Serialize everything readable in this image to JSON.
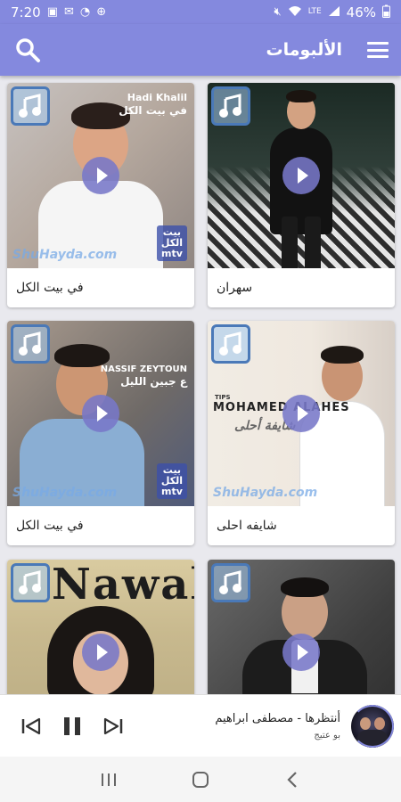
{
  "status": {
    "time": "7:20",
    "battery": "46%",
    "left_icons": [
      "gallery-icon",
      "mail-icon",
      "whatsapp-icon",
      "vpn-icon"
    ],
    "right_icons": [
      "mute-icon",
      "wifi-icon",
      "lte-icon",
      "signal-icon",
      "battery-icon"
    ]
  },
  "app_bar": {
    "title": "الألبومات",
    "accent": "#8489de"
  },
  "albums": [
    {
      "label": "في بيت الكل",
      "artist_line1": "Hadi Khalil",
      "artist_line2": "في بيت الكل",
      "watermark": "ShuHayda.com",
      "badge_line1": "بيت",
      "badge_line2": "الكل",
      "badge_line3": "mtv"
    },
    {
      "label": "سهران"
    },
    {
      "label": "في بيت الكل",
      "artist_line1": "NASSIF ZEYTOUN",
      "artist_line2": "ع جبين الليل",
      "watermark": "ShuHayda.com",
      "badge_line1": "بيت",
      "badge_line2": "الكل",
      "badge_line3": "mtv"
    },
    {
      "label": "شايفه احلى",
      "artist_line1": "TIPS",
      "artist_line2": "MOHAMED ALAHES",
      "script": "شايفة أحلى",
      "watermark": "ShuHayda.com"
    },
    {
      "cover_text": "Nawal"
    },
    {}
  ],
  "player": {
    "title": "أنتظرها - مصطفى ابراهيم",
    "subtitle": "بو عتيج"
  }
}
